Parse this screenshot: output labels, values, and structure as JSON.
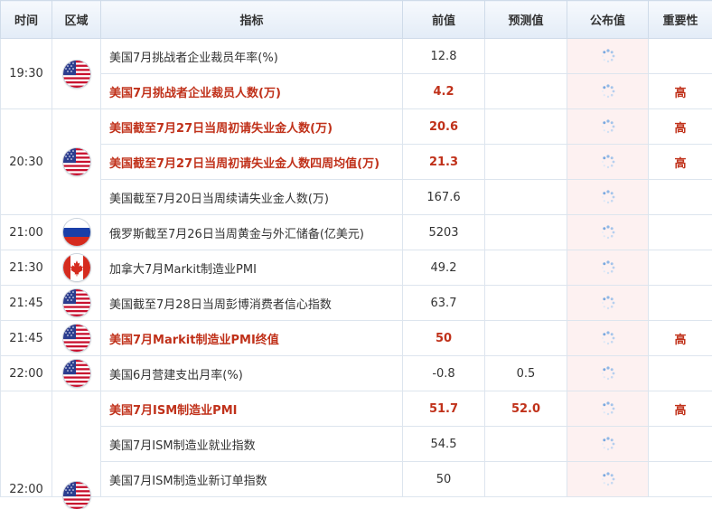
{
  "headers": {
    "time": "时间",
    "region": "区域",
    "indicator": "指标",
    "previous": "前值",
    "forecast": "预测值",
    "published": "公布值",
    "importance": "重要性"
  },
  "icons": {
    "loading": "loading-spinner-icon"
  },
  "colors": {
    "highlight": "#c0311a",
    "published_bg": "#fdf1f1",
    "header_bg": "#e3ecf7"
  },
  "rows": [
    {
      "time": "19:30",
      "region": "us",
      "indicator": "美国7月挑战者企业裁员年率(%)",
      "previous": "12.8",
      "forecast": "",
      "importance": ""
    },
    {
      "time": "",
      "region": "",
      "indicator": "美国7月挑战者企业裁员人数(万)",
      "previous": "4.2",
      "forecast": "",
      "importance": "高"
    },
    {
      "time": "20:30",
      "region": "us",
      "indicator": "美国截至7月27日当周初请失业金人数(万)",
      "previous": "20.6",
      "forecast": "",
      "importance": "高"
    },
    {
      "time": "",
      "region": "",
      "indicator": "美国截至7月27日当周初请失业金人数四周均值(万)",
      "previous": "21.3",
      "forecast": "",
      "importance": "高"
    },
    {
      "time": "",
      "region": "",
      "indicator": "美国截至7月20日当周续请失业金人数(万)",
      "previous": "167.6",
      "forecast": "",
      "importance": ""
    },
    {
      "time": "21:00",
      "region": "ru",
      "indicator": "俄罗斯截至7月26日当周黄金与外汇储备(亿美元)",
      "previous": "5203",
      "forecast": "",
      "importance": ""
    },
    {
      "time": "21:30",
      "region": "ca",
      "indicator": "加拿大7月Markit制造业PMI",
      "previous": "49.2",
      "forecast": "",
      "importance": ""
    },
    {
      "time": "21:45",
      "region": "us",
      "indicator": "美国截至7月28日当周彭博消费者信心指数",
      "previous": "63.7",
      "forecast": "",
      "importance": ""
    },
    {
      "time": "21:45",
      "region": "us",
      "indicator": "美国7月Markit制造业PMI终值",
      "previous": "50",
      "forecast": "",
      "importance": "高"
    },
    {
      "time": "22:00",
      "region": "us",
      "indicator": "美国6月营建支出月率(%)",
      "previous": "-0.8",
      "forecast": "0.5",
      "importance": ""
    },
    {
      "time": "",
      "region": "",
      "indicator": "美国7月ISM制造业PMI",
      "previous": "51.7",
      "forecast": "52.0",
      "importance": "高"
    },
    {
      "time": "",
      "region": "",
      "indicator": "美国7月ISM制造业就业指数",
      "previous": "54.5",
      "forecast": "",
      "importance": ""
    },
    {
      "time": "22:00",
      "region": "us",
      "indicator": "美国7月ISM制造业新订单指数",
      "previous": "50",
      "forecast": "",
      "importance": ""
    }
  ]
}
